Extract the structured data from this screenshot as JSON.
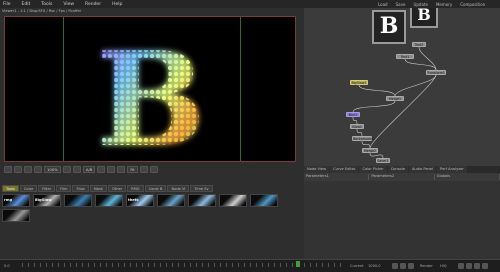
{
  "menu": {
    "file": "File",
    "edit": "Edit",
    "tools": "Tools",
    "view": "View",
    "render": "Render",
    "help": "Help"
  },
  "topbar": {
    "load": "Load",
    "save": "Save",
    "update": "Update",
    "memory": "Memory",
    "composition": "Composition"
  },
  "viewer": {
    "title": "Viewer1 - 1:1 / Disp/SFX / Rsc / Fps / Fbuffer",
    "letter": "B"
  },
  "viewer_toolbar": {
    "zoom": "100%",
    "a_label": "A/B",
    "fit": "Fit"
  },
  "bin_tabs": [
    "Tools",
    "Color",
    "Filter",
    "Film",
    "Flow",
    "Mask",
    "Other",
    "RMG",
    "Const B",
    "Node Vi",
    "Time Sv"
  ],
  "thumbs": [
    {
      "label": "rmg",
      "color": "#5b8fd8"
    },
    {
      "label": "BigGlow",
      "color": "#b0b0b0"
    },
    {
      "label": "",
      "color": "#3b7fb0"
    },
    {
      "label": "",
      "color": "#5fb5d8"
    },
    {
      "label": "thefx",
      "color": "#9ecbef"
    },
    {
      "label": "",
      "color": "#6aa2c8"
    },
    {
      "label": "",
      "color": "#8cbadf"
    },
    {
      "label": "",
      "color": "#cfcfcf"
    },
    {
      "label": "",
      "color": "#4f95c0"
    },
    {
      "label": "",
      "color": "#999999"
    }
  ],
  "flow": {
    "nodes": [
      {
        "label": "Text1",
        "kind": "gray"
      },
      {
        "label": "Text2",
        "kind": "gray"
      },
      {
        "label": "Transform1",
        "kind": "gray"
      },
      {
        "label": "BigGlow1",
        "kind": "yellow"
      },
      {
        "label": "Merge1",
        "kind": "gray"
      },
      {
        "label": "Blur1",
        "kind": "purple"
      },
      {
        "label": "Glow1",
        "kind": "gray"
      },
      {
        "label": "Background1",
        "kind": "gray"
      },
      {
        "label": "Merge2",
        "kind": "gray"
      },
      {
        "label": "Saver1",
        "kind": "gray"
      }
    ],
    "preview_letter": "B"
  },
  "ctrl_tabs": [
    "Node View",
    "Curve Editor",
    "Color Picker",
    "Console",
    "Audio Panel",
    "Perf Analyzer"
  ],
  "ctrl_row": [
    "Parameters1",
    "Parameters2",
    "Globals"
  ],
  "timeline": {
    "start": "0.0",
    "current": "Current",
    "end": "1000.0",
    "render": "Render",
    "hiq": "HiQ"
  },
  "colors": {
    "bg": "#2b2b2b",
    "viewer_border": "#7a3b3b",
    "guide": "#2d6b2d",
    "accent": "#7a7324"
  }
}
